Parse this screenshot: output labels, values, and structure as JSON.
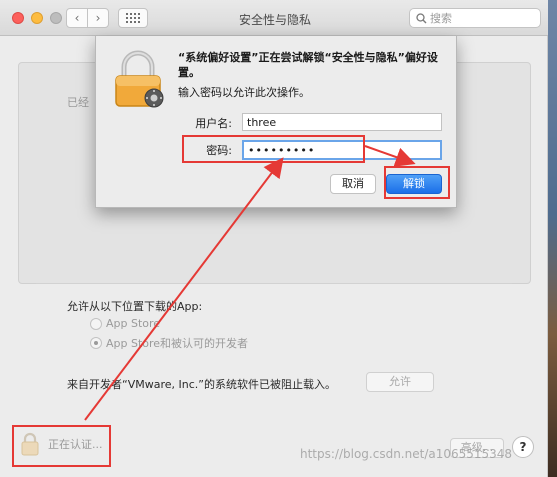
{
  "window": {
    "title": "安全性与隐私",
    "search_placeholder": "搜索"
  },
  "background": {
    "pane_label": "已经",
    "allow_label": "允许从以下位置下载的App:",
    "radio_options": [
      "App Store",
      "App Store和被认可的开发者"
    ],
    "blocked_text": "来自开发者“VMware, Inc.”的系统软件已被阻止载入。",
    "allow_button": "允许",
    "lock_label": "正在认证...",
    "advanced_button": "高级...",
    "help_button": "?"
  },
  "dialog": {
    "title": "“系统偏好设置”正在尝试解锁“安全性与隐私”偏好设置。",
    "message": "输入密码以允许此次操作。",
    "username_label": "用户名:",
    "username_value": "three",
    "password_label": "密码:",
    "password_value": "•••••••••",
    "cancel_button": "取消",
    "unlock_button": "解锁"
  },
  "watermark": "https://blog.csdn.net/a1065515348",
  "colors": {
    "annotation": "#e53935",
    "unlock_button": "#1b6fe8",
    "focus_ring": "#6aa5e9"
  }
}
